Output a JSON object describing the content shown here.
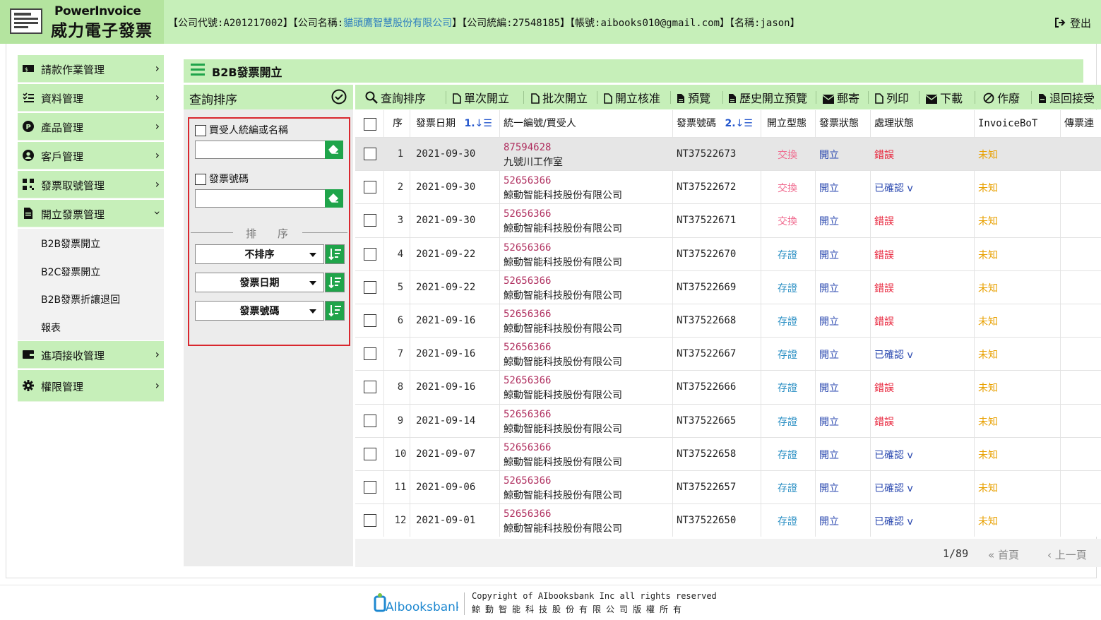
{
  "header": {
    "brand_en": "PowerInvoice",
    "brand_zh": "威力電子發票",
    "info_company_code": "【公司代號:A201217002】",
    "info_company_name_prefix": "【公司名稱:",
    "info_company_name": "貓頭鷹智慧股份有限公司",
    "info_company_name_suffix": "】",
    "info_tax_id": "【公司統編:27548185】",
    "info_account": "【帳號:aibooks010@gmail.com】",
    "info_name": "【名稱:jason】",
    "logout_label": "登出"
  },
  "sidebar": {
    "items": [
      {
        "label": "請款作業管理",
        "icon": "money-bill-icon"
      },
      {
        "label": "資料管理",
        "icon": "list-check-icon"
      },
      {
        "label": "產品管理",
        "icon": "product-p-icon"
      },
      {
        "label": "客戶管理",
        "icon": "user-circle-icon"
      },
      {
        "label": "發票取號管理",
        "icon": "qrcode-icon"
      },
      {
        "label": "開立發票管理",
        "icon": "file-icon"
      }
    ],
    "subitems": [
      "B2B發票開立",
      "B2C發票開立",
      "B2B發票折讓退回",
      "報表"
    ],
    "items2": [
      {
        "label": "進項接收管理",
        "icon": "wallet-icon"
      },
      {
        "label": "權限管理",
        "icon": "gear-icon"
      }
    ]
  },
  "page": {
    "title": "B2B發票開立"
  },
  "query": {
    "title": "查詢排序",
    "buyer_label": "買受人統編或名稱",
    "buyer_value": "",
    "invoice_label": "發票號碼",
    "invoice_value": "",
    "sort_divider": "排序",
    "sort_options": [
      "不排序",
      "發票日期",
      "發票號碼"
    ]
  },
  "toolbar": {
    "buttons": [
      "查詢排序",
      "單次開立",
      "批次開立",
      "開立核准",
      "預覽",
      "歷史開立預覽",
      "郵寄",
      "列印",
      "下載",
      "作廢",
      "退回接受"
    ]
  },
  "table": {
    "headers": {
      "seq": "序",
      "date": "發票日期",
      "date_sort": "1.",
      "buyer": "統一編號/買受人",
      "invno": "發票號碼",
      "invno_sort": "2.",
      "itype": "開立型態",
      "istat": "發票狀態",
      "pstat": "處理狀態",
      "bot": "InvoiceBoT",
      "relay": "傳票連結"
    },
    "rows": [
      {
        "seq": "1",
        "date": "2021-09-30",
        "taxid": "87594628",
        "buyer": "九號川工作室",
        "invno": "NT37522673",
        "itype": "交換",
        "istat": "開立",
        "pstat": "錯誤",
        "bot": "未知"
      },
      {
        "seq": "2",
        "date": "2021-09-30",
        "taxid": "52656366",
        "buyer": "鯨動智能科技股份有限公司",
        "invno": "NT37522672",
        "itype": "交換",
        "istat": "開立",
        "pstat": "已確認 v",
        "bot": "未知"
      },
      {
        "seq": "3",
        "date": "2021-09-30",
        "taxid": "52656366",
        "buyer": "鯨動智能科技股份有限公司",
        "invno": "NT37522671",
        "itype": "交換",
        "istat": "開立",
        "pstat": "錯誤",
        "bot": "未知"
      },
      {
        "seq": "4",
        "date": "2021-09-22",
        "taxid": "52656366",
        "buyer": "鯨動智能科技股份有限公司",
        "invno": "NT37522670",
        "itype": "存證",
        "istat": "開立",
        "pstat": "錯誤",
        "bot": "未知"
      },
      {
        "seq": "5",
        "date": "2021-09-22",
        "taxid": "52656366",
        "buyer": "鯨動智能科技股份有限公司",
        "invno": "NT37522669",
        "itype": "存證",
        "istat": "開立",
        "pstat": "錯誤",
        "bot": "未知"
      },
      {
        "seq": "6",
        "date": "2021-09-16",
        "taxid": "52656366",
        "buyer": "鯨動智能科技股份有限公司",
        "invno": "NT37522668",
        "itype": "存證",
        "istat": "開立",
        "pstat": "錯誤",
        "bot": "未知"
      },
      {
        "seq": "7",
        "date": "2021-09-16",
        "taxid": "52656366",
        "buyer": "鯨動智能科技股份有限公司",
        "invno": "NT37522667",
        "itype": "存證",
        "istat": "開立",
        "pstat": "已確認 v",
        "bot": "未知"
      },
      {
        "seq": "8",
        "date": "2021-09-16",
        "taxid": "52656366",
        "buyer": "鯨動智能科技股份有限公司",
        "invno": "NT37522666",
        "itype": "存證",
        "istat": "開立",
        "pstat": "錯誤",
        "bot": "未知"
      },
      {
        "seq": "9",
        "date": "2021-09-14",
        "taxid": "52656366",
        "buyer": "鯨動智能科技股份有限公司",
        "invno": "NT37522665",
        "itype": "存證",
        "istat": "開立",
        "pstat": "錯誤",
        "bot": "未知"
      },
      {
        "seq": "10",
        "date": "2021-09-07",
        "taxid": "52656366",
        "buyer": "鯨動智能科技股份有限公司",
        "invno": "NT37522658",
        "itype": "存證",
        "istat": "開立",
        "pstat": "已確認 v",
        "bot": "未知"
      },
      {
        "seq": "11",
        "date": "2021-09-06",
        "taxid": "52656366",
        "buyer": "鯨動智能科技股份有限公司",
        "invno": "NT37522657",
        "itype": "存證",
        "istat": "開立",
        "pstat": "已確認 v",
        "bot": "未知"
      },
      {
        "seq": "12",
        "date": "2021-09-01",
        "taxid": "52656366",
        "buyer": "鯨動智能科技股份有限公司",
        "invno": "NT37522650",
        "itype": "存證",
        "istat": "開立",
        "pstat": "已確認 v",
        "bot": "未知"
      }
    ]
  },
  "pager": {
    "page": "1/89",
    "first": "首頁",
    "prev": "上一頁"
  },
  "footer": {
    "logo_text": "AIbooksbank",
    "copyright": "Copyright of AIbooksbank Inc all rights reserved",
    "copyright_zh": "鯨動智能科技股份有限公司版權所有"
  },
  "colors": {
    "header_green": "#c6efb9",
    "action_green": "#1fa44a",
    "highlight_red": "#d9272e"
  }
}
